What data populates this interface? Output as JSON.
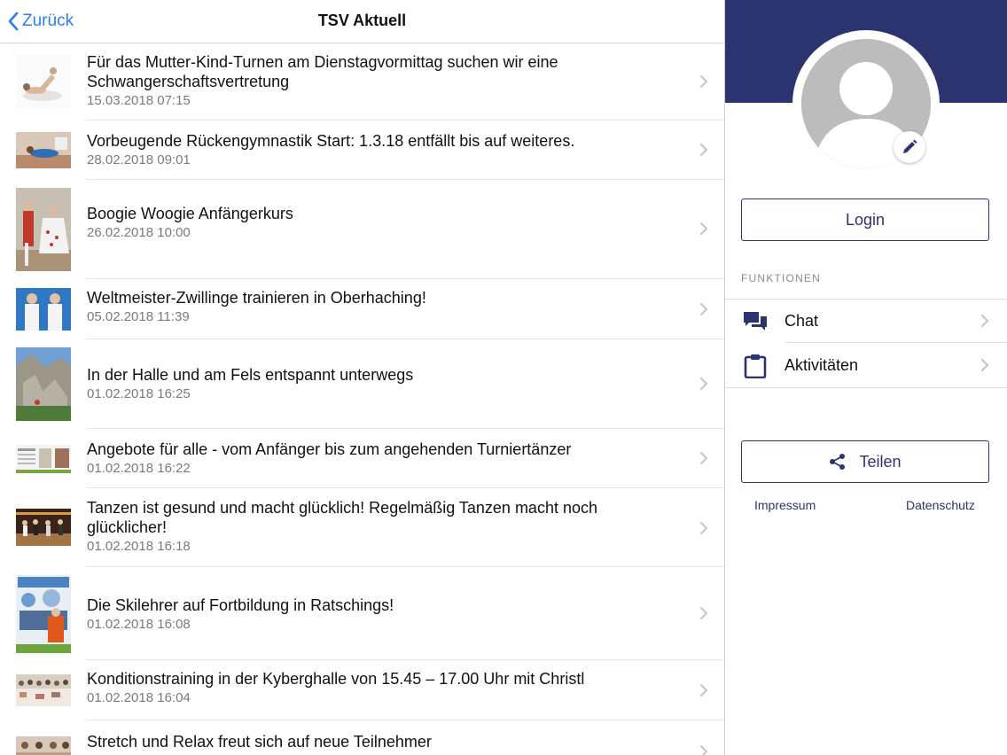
{
  "navbar": {
    "back_label": "Zurück",
    "title": "TSV Aktuell"
  },
  "news": [
    {
      "title": "Für das Mutter-Kind-Turnen am Dienstagvormittag suchen wir eine Schwangerschaftsvertretung",
      "date": "15.03.2018 07:15"
    },
    {
      "title": "Vorbeugende Rückengymnastik Start: 1.3.18 entfällt bis auf weiteres.",
      "date": "28.02.2018 09:01"
    },
    {
      "title": "Boogie Woogie Anfängerkurs",
      "date": "26.02.2018 10:00"
    },
    {
      "title": "Weltmeister-Zwillinge trainieren in Oberhaching!",
      "date": "05.02.2018 11:39"
    },
    {
      "title": "In der Halle und am Fels entspannt unterwegs",
      "date": "01.02.2018 16:25"
    },
    {
      "title": "Angebote für alle - vom Anfänger bis zum angehenden Turniertänzer",
      "date": "01.02.2018 16:22"
    },
    {
      "title": "Tanzen ist gesund und macht glücklich! Regelmäßig Tanzen macht noch glücklicher!",
      "date": "01.02.2018 16:18"
    },
    {
      "title": "Die Skilehrer auf Fortbildung in Ratschings!",
      "date": "01.02.2018 16:08"
    },
    {
      "title": "Konditionstraining in der Kyberghalle von 15.45 – 17.00 Uhr mit Christl",
      "date": "01.02.2018 16:04"
    },
    {
      "title": "Stretch und Relax freut sich auf neue Teilnehmer",
      "date": ""
    }
  ],
  "sidebar": {
    "login_label": "Login",
    "section_title": "FUNKTIONEN",
    "functions": [
      {
        "label": "Chat",
        "icon": "chat-icon"
      },
      {
        "label": "Aktivitäten",
        "icon": "clipboard-icon"
      }
    ],
    "share_label": "Teilen",
    "impressum_label": "Impressum",
    "datenschutz_label": "Datenschutz"
  },
  "colors": {
    "brand": "#2c3470",
    "link_blue": "#2b7cf0"
  }
}
